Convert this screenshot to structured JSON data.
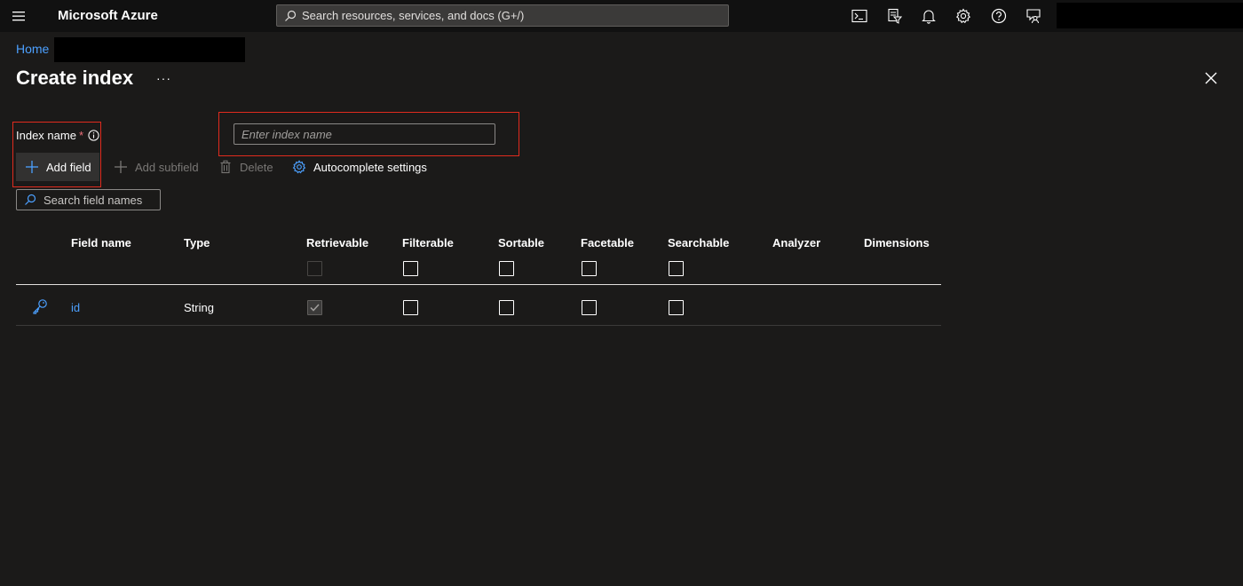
{
  "topbar": {
    "brand": "Microsoft Azure",
    "search_placeholder": "Search resources, services, and docs (G+/)",
    "icons": [
      "menu-icon",
      "cloud-shell-icon",
      "directory-filter-icon",
      "notifications-icon",
      "settings-icon",
      "help-icon",
      "feedback-icon"
    ]
  },
  "breadcrumb": {
    "home": "Home"
  },
  "header": {
    "title": "Create index",
    "more": "···"
  },
  "form": {
    "index_name_label": "Index name",
    "required_mark": "*",
    "index_name_placeholder": "Enter index name"
  },
  "toolbar": {
    "add_field": "Add field",
    "add_subfield": "Add subfield",
    "delete": "Delete",
    "autocomplete": "Autocomplete settings"
  },
  "field_search": {
    "placeholder": "Search field names"
  },
  "table": {
    "columns": [
      "Field name",
      "Type",
      "Retrievable",
      "Filterable",
      "Sortable",
      "Facetable",
      "Searchable",
      "Analyzer",
      "Dimensions"
    ],
    "rows": [
      {
        "field_name": "id",
        "type": "String",
        "retrievable": true,
        "filterable": false,
        "sortable": false,
        "facetable": false,
        "searchable": false
      }
    ]
  },
  "colors": {
    "accent": "#4ca0ff",
    "highlight": "#e02b1e",
    "background": "#1b1a19",
    "topbar": "#111111"
  }
}
